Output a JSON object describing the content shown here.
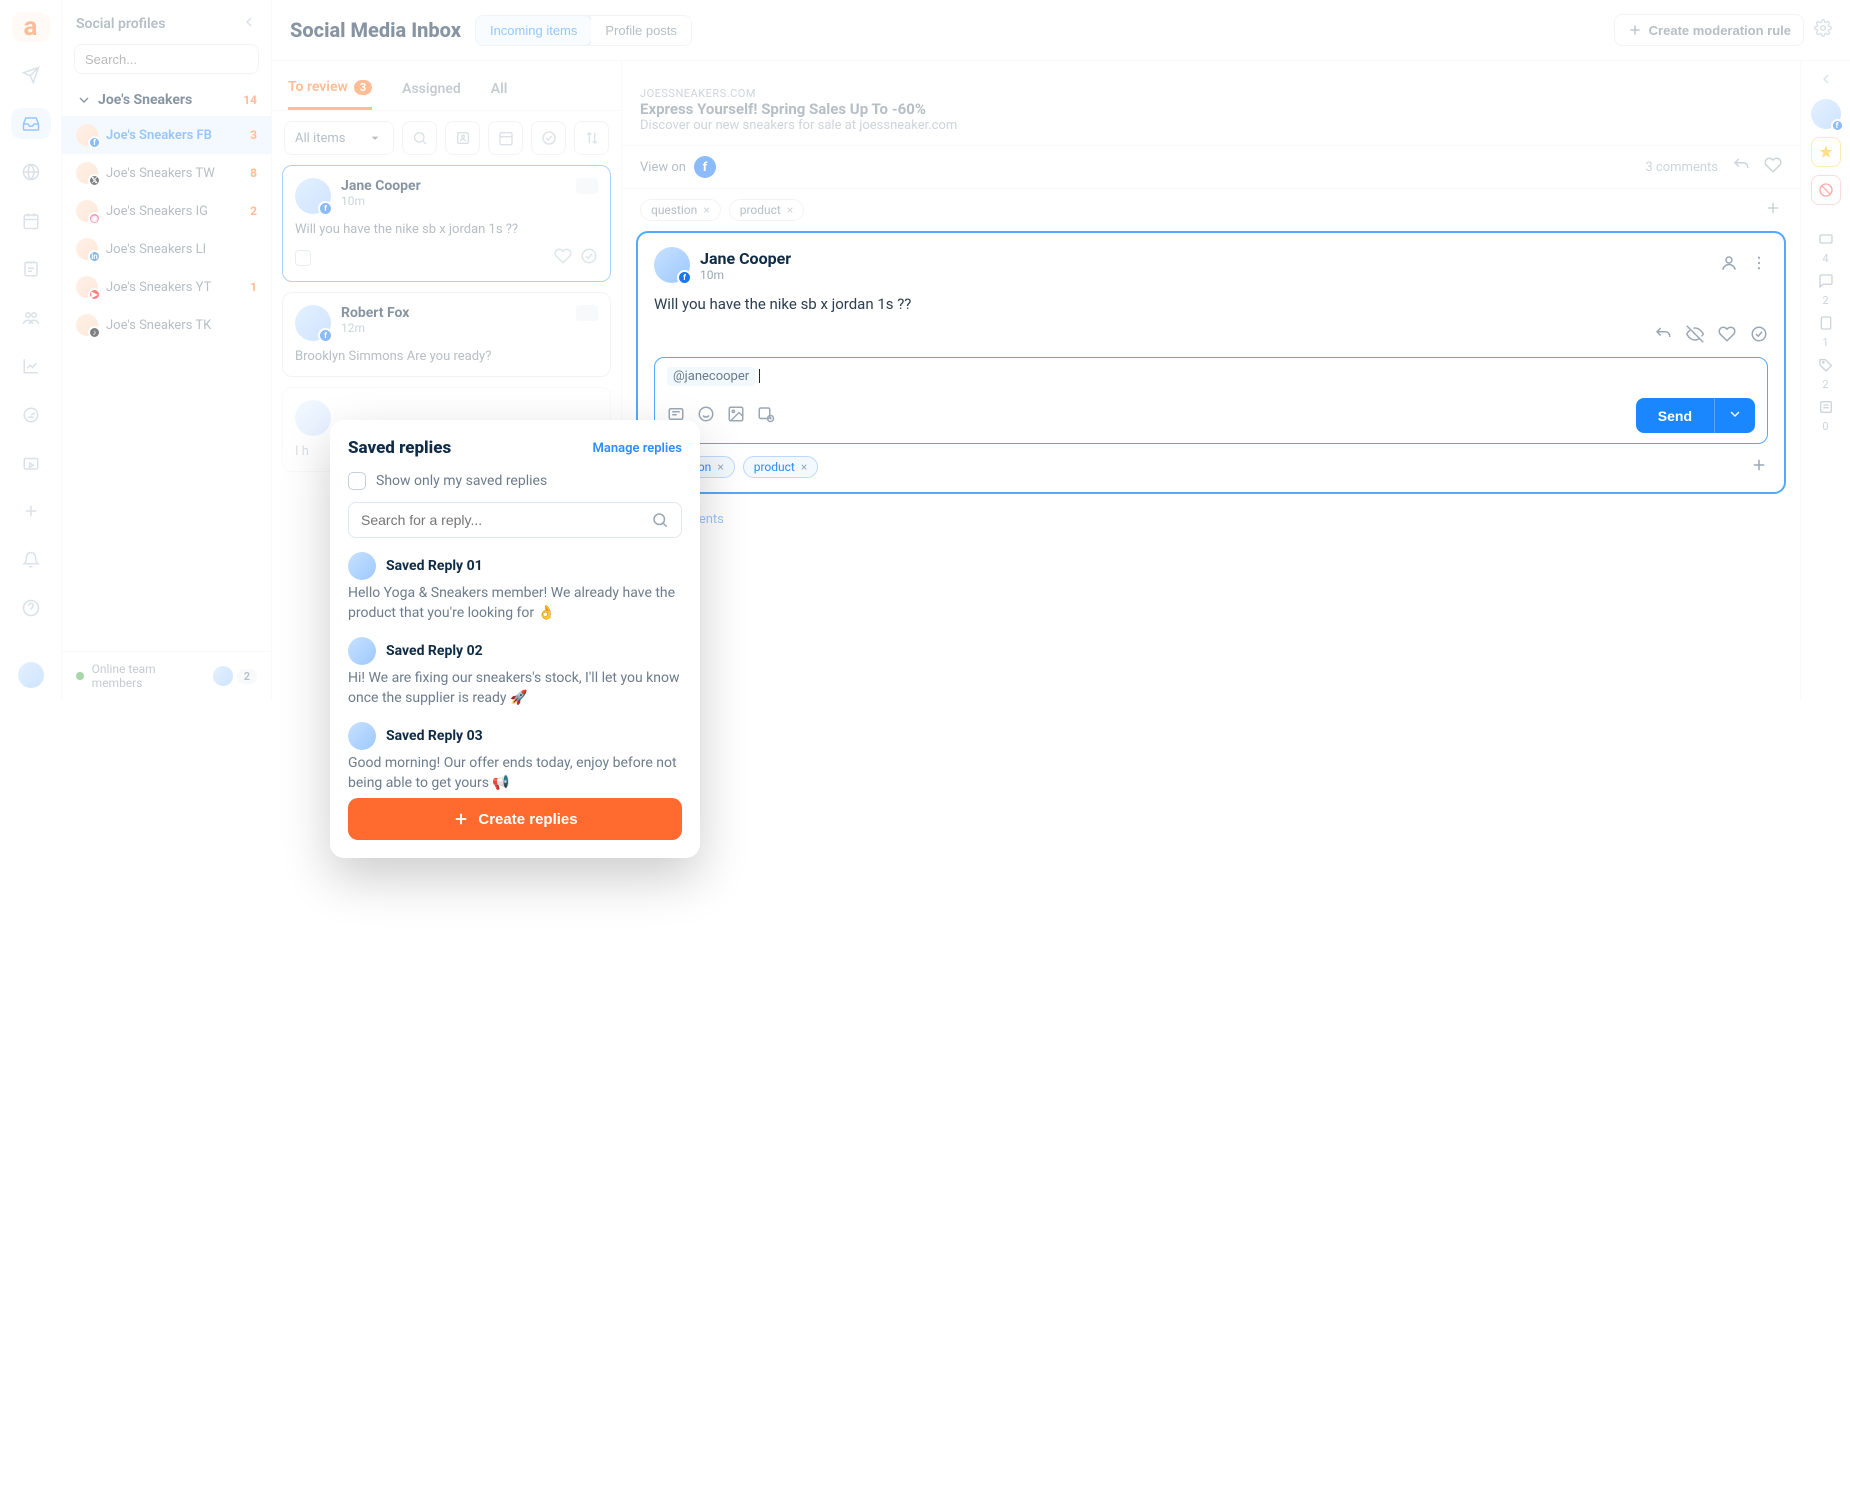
{
  "header": {
    "title": "Social Media Inbox",
    "seg": [
      "Incoming items",
      "Profile posts"
    ],
    "create_rule": "Create moderation rule"
  },
  "profiles": {
    "panel_title": "Social profiles",
    "search_placeholder": "Search...",
    "group": {
      "name": "Joe's Sneakers",
      "count": "14"
    },
    "items": [
      {
        "label": "Joe's Sneakers FB",
        "count": "3",
        "network": "fb"
      },
      {
        "label": "Joe's Sneakers TW",
        "count": "8",
        "network": "tw"
      },
      {
        "label": "Joe's Sneakers IG",
        "count": "2",
        "network": "ig"
      },
      {
        "label": "Joe's Sneakers LI",
        "count": "",
        "network": "li"
      },
      {
        "label": "Joe's Sneakers YT",
        "count": "1",
        "network": "yt"
      },
      {
        "label": "Joe's Sneakers TK",
        "count": "",
        "network": "tk"
      }
    ],
    "online_label": "Online team members",
    "online_count": "2"
  },
  "inbox": {
    "tabs": {
      "to_review": "To review",
      "to_review_count": "3",
      "assigned": "Assigned",
      "all": "All"
    },
    "filter_label": "All items",
    "messages": [
      {
        "name": "Jane Cooper",
        "time": "10m",
        "text": "Will you have the nike sb x jordan 1s ??"
      },
      {
        "name": "Robert Fox",
        "time": "12m",
        "text": "Brooklyn Simmons Are you ready?"
      },
      {
        "name": "",
        "time": "",
        "text": "I h"
      }
    ]
  },
  "detail": {
    "promo_domain": "JOESSNEAKERS.COM",
    "promo_title": "Express Yourself! Spring Sales Up To -60%",
    "promo_sub": "Discover our new sneakers for sale at joessneaker.com",
    "view_on": "View on",
    "comments": "3 comments",
    "tags": [
      "question",
      "product"
    ],
    "author": "Jane Cooper",
    "time": "10m",
    "body": "Will you have the nike sb x jordan 1s ??",
    "mention": "@janecooper",
    "send": "Send",
    "more": "ore comments"
  },
  "right_rail": {
    "counts": [
      "4",
      "2",
      "1",
      "2",
      "0"
    ]
  },
  "popover": {
    "title": "Saved replies",
    "manage": "Manage replies",
    "show_only": "Show only my saved replies",
    "search_placeholder": "Search for a reply...",
    "replies": [
      {
        "title": "Saved Reply 01",
        "text": "Hello Yoga & Sneakers member! We already have the product that you're looking for 👌"
      },
      {
        "title": "Saved Reply 02",
        "text": "Hi! We are fixing our sneakers's stock, I'll let you know once the supplier is ready 🚀"
      },
      {
        "title": "Saved Reply 03",
        "text": "Good morning! Our offer ends today, enjoy before not being able to get yours 📢"
      }
    ],
    "create": "Create replies"
  }
}
